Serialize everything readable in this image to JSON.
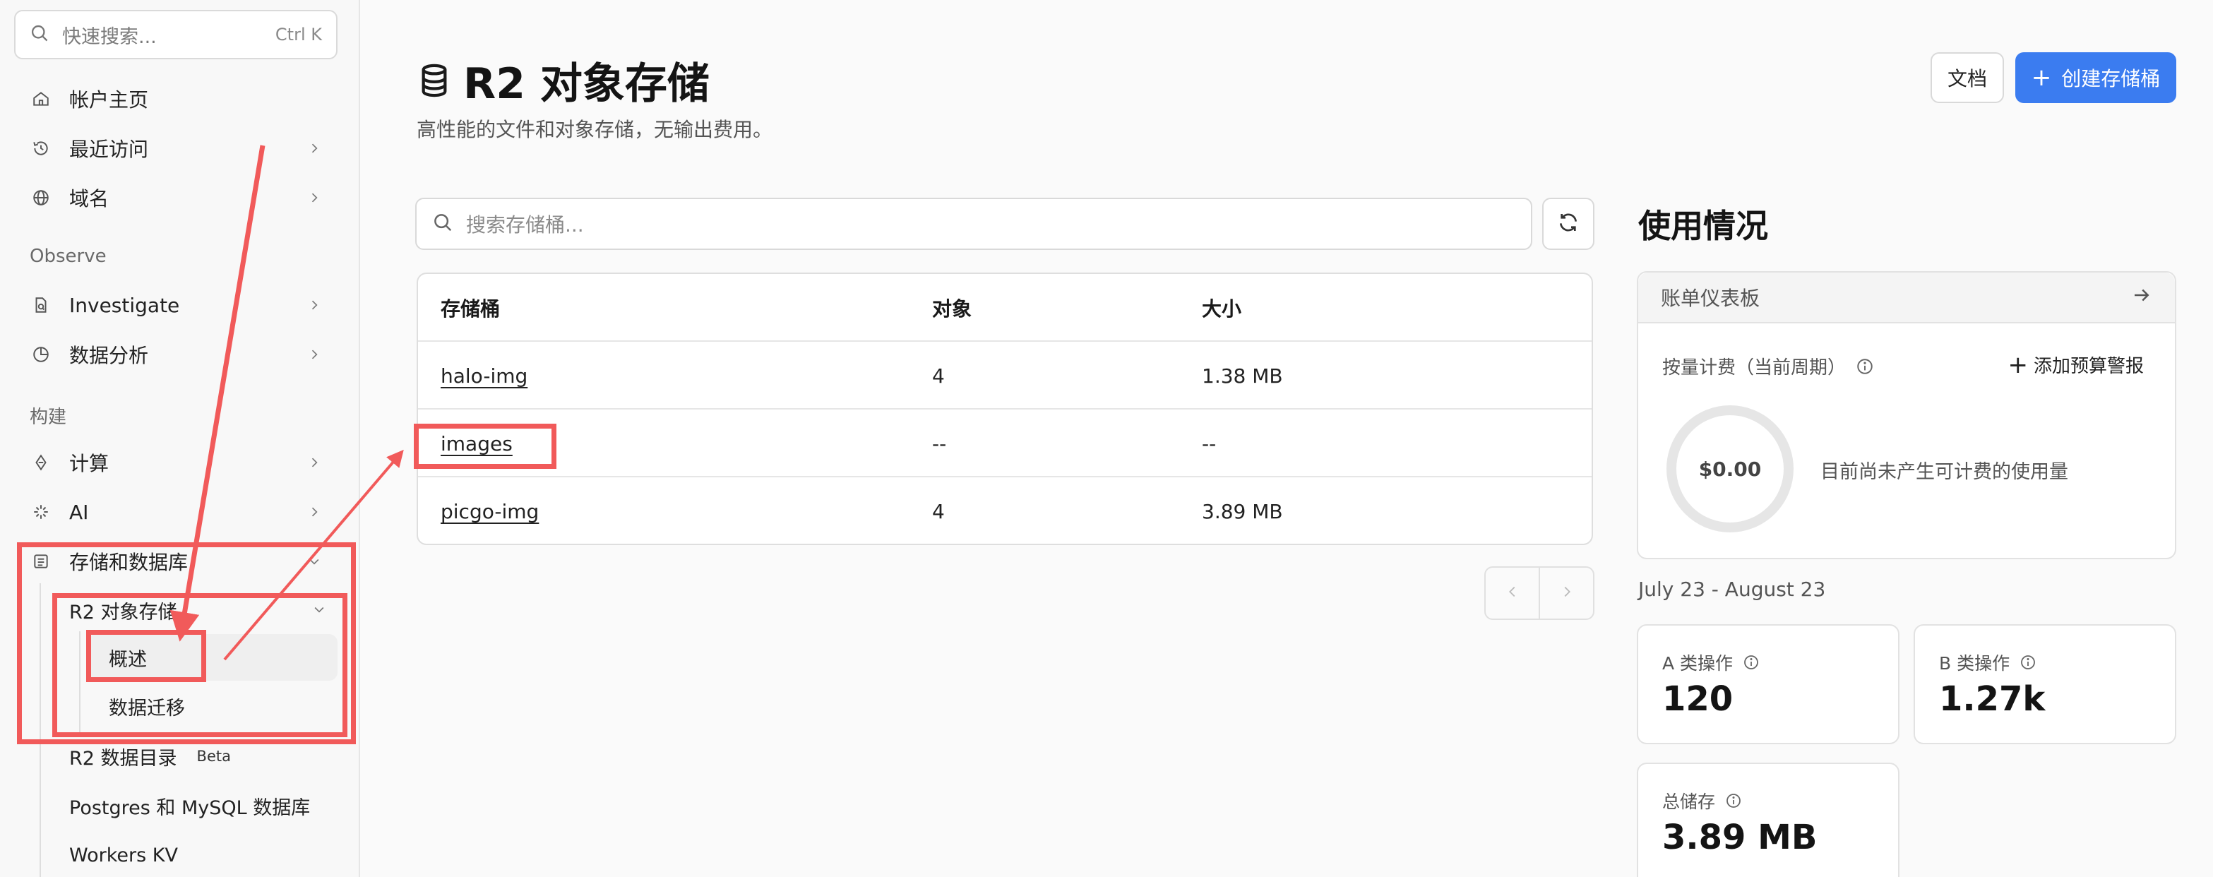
{
  "sidebar": {
    "search": {
      "placeholder": "快速搜索...",
      "shortcut": "Ctrl K"
    },
    "items": [
      {
        "label": "帐户主页",
        "icon": "home-icon"
      },
      {
        "label": "最近访问",
        "icon": "history-icon"
      },
      {
        "label": "域名",
        "icon": "globe-icon"
      }
    ],
    "section_observe": "Observe",
    "observe_items": [
      {
        "label": "Investigate",
        "icon": "document-search-icon"
      },
      {
        "label": "数据分析",
        "icon": "pie-chart-icon"
      }
    ],
    "section_build": "构建",
    "build_items": [
      {
        "label": "计算",
        "icon": "diamond-icon"
      },
      {
        "label": "AI",
        "icon": "sparkle-icon"
      },
      {
        "label": "存储和数据库",
        "icon": "database-stack-icon"
      }
    ],
    "r2": {
      "label": "R2 对象存储",
      "children": [
        "概述",
        "数据迁移"
      ]
    },
    "storage_children": [
      {
        "label": "R2 数据目录",
        "badge": "Beta"
      },
      {
        "label": "Postgres 和 MySQL 数据库"
      },
      {
        "label": "Workers KV"
      }
    ]
  },
  "header": {
    "title": "R2 对象存储",
    "subtitle": "高性能的文件和对象存储，无输出费用。",
    "docs_label": "文档",
    "create_label": "创建存储桶"
  },
  "buckets": {
    "search_placeholder": "搜索存储桶...",
    "columns": [
      "存储桶",
      "对象",
      "大小"
    ],
    "rows": [
      {
        "name": "halo-img",
        "objects": "4",
        "size": "1.38 MB"
      },
      {
        "name": "images",
        "objects": "--",
        "size": "--"
      },
      {
        "name": "picgo-img",
        "objects": "4",
        "size": "3.89 MB"
      }
    ]
  },
  "usage": {
    "title": "使用情况",
    "billing_link": "账单仪表板",
    "billing_subtitle": "按量计费（当前周期）",
    "add_alert": "添加预算警报",
    "amount": "$0.00",
    "no_usage": "目前尚未产生可计费的使用量",
    "period": "July 23 - August 23",
    "stats": [
      {
        "label": "A 类操作",
        "value": "120"
      },
      {
        "label": "B 类操作",
        "value": "1.27k"
      },
      {
        "label": "总储存",
        "value": "3.89 MB"
      }
    ]
  },
  "colors": {
    "accent": "#3b7cf0",
    "annotation": "#f15a5a"
  }
}
